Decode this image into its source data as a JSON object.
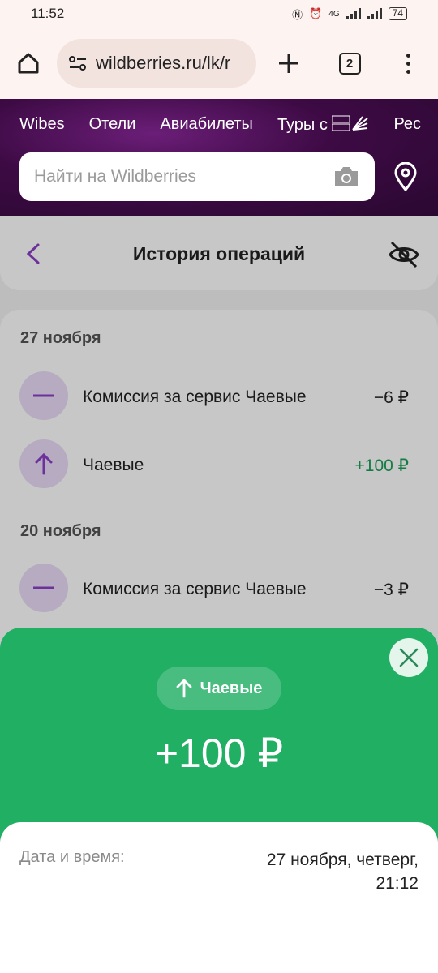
{
  "status_bar": {
    "time": "11:52",
    "network": "4G",
    "battery": "74"
  },
  "browser": {
    "url": "wildberries.ru/lk/r",
    "tab_count": "2"
  },
  "wb": {
    "nav": [
      "Wibes",
      "Отели",
      "Авиабилеты",
      "Туры с",
      "Рес"
    ],
    "search_placeholder": "Найти на Wildberries"
  },
  "page": {
    "title": "История операций"
  },
  "operations": [
    {
      "date": "27 ноября",
      "items": [
        {
          "icon": "minus-icon",
          "title": "Комиссия за сервис Чаевые",
          "amount": "−6 ₽",
          "positive": false
        },
        {
          "icon": "arrow-up-icon",
          "title": "Чаевые",
          "amount": "+100 ₽",
          "positive": true
        }
      ]
    },
    {
      "date": "20 ноября",
      "items": [
        {
          "icon": "minus-icon",
          "title": "Комиссия за сервис Чаевые",
          "amount": "−3 ₽",
          "positive": false
        }
      ]
    }
  ],
  "sheet": {
    "chip_label": "Чаевые",
    "amount": "+100 ₽",
    "detail_label": "Дата и время:",
    "detail_value": "27 ноября, четверг, 21:12"
  },
  "colors": {
    "sheet_green": "#21af64",
    "accent_purple": "#8b3fc6",
    "positive_green": "#1a9e55"
  }
}
